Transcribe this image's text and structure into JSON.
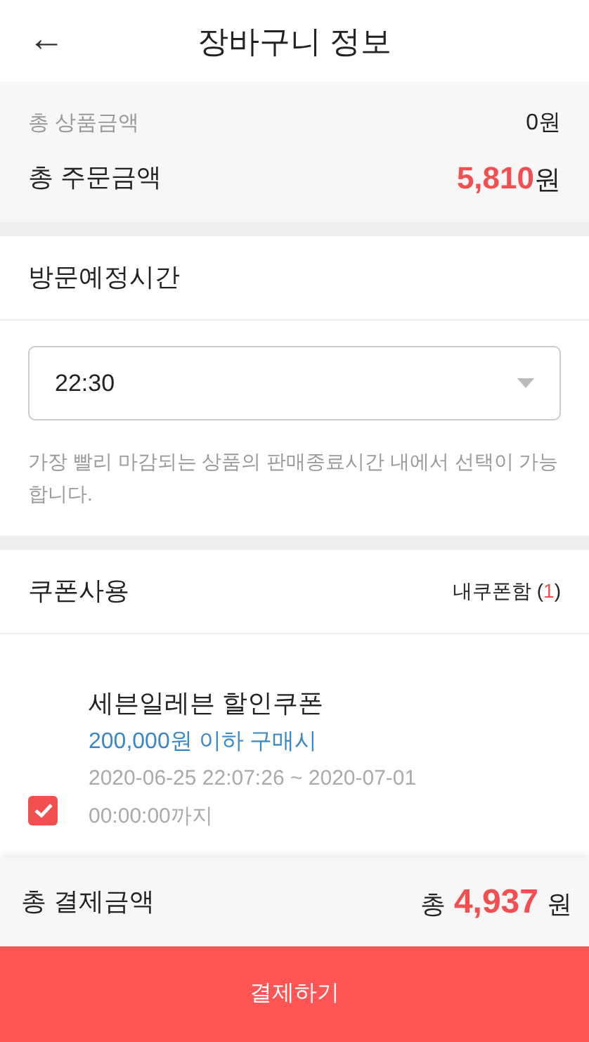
{
  "header": {
    "back_icon": "←",
    "title": "장바구니 정보"
  },
  "summary": {
    "rows": [
      {
        "kind": "sub",
        "label": "총 상품금액",
        "amount": "0",
        "unit": "원"
      },
      {
        "kind": "main",
        "label": "총 주문금액",
        "amount": "5,810",
        "unit": "원"
      }
    ]
  },
  "visit_time": {
    "title": "방문예정시간",
    "value": "22:30",
    "note": "가장 빨리 마감되는 상품의 판매종료시간 내에서 선택이 가능합니다."
  },
  "coupons": {
    "title": "쿠폰사용",
    "box_label": "내쿠폰함 (",
    "box_count": "1",
    "box_suffix": ")",
    "items": [
      {
        "name": "세븐일레븐 할인쿠폰",
        "condition": "200,000원 이하 구매시",
        "period": "2020-06-25 22:07:26 ~ 2020-07-01 00:00:00까지",
        "checked": true
      }
    ]
  },
  "footer": {
    "label": "총 결제금액",
    "prefix": "총",
    "amount": "4,937",
    "unit": "원",
    "pay_button": "결제하기"
  }
}
